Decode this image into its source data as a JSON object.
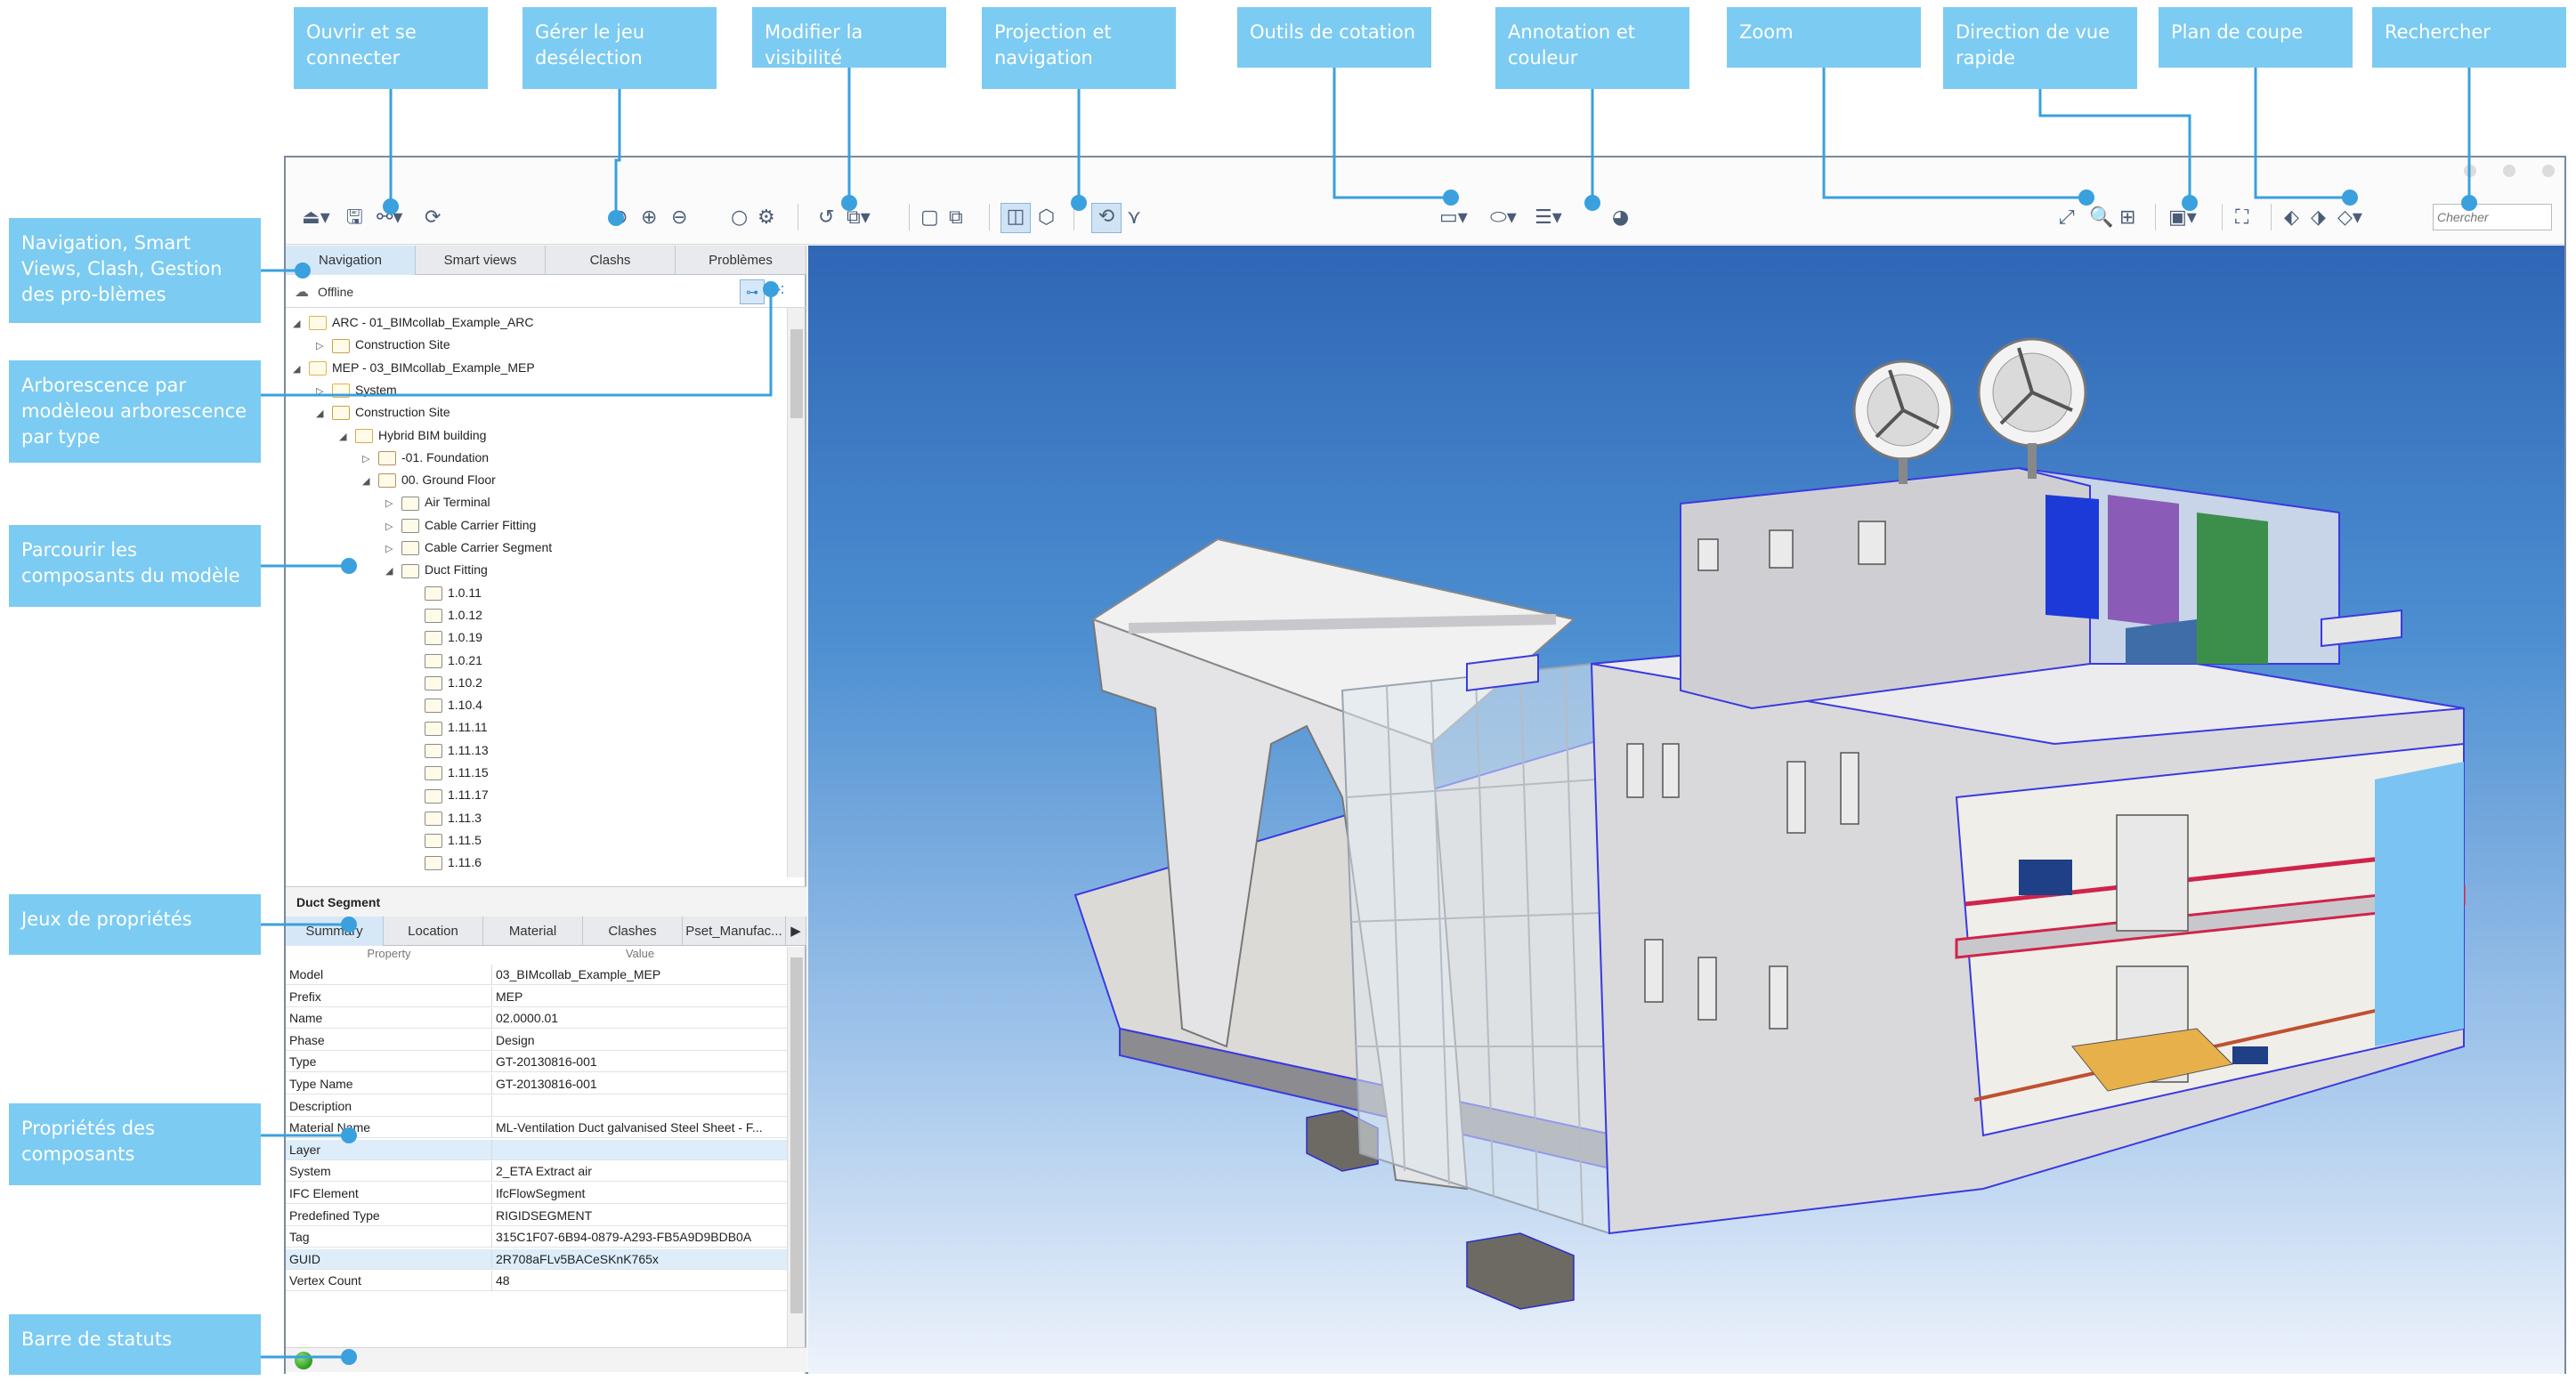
{
  "callouts_top": [
    "Ouvrir et se connecter",
    "Gérer le jeu desélection",
    "Modifier la visibilité",
    "Projection et navigation",
    "Outils de cotation",
    "Annotation et couleur",
    "Zoom",
    "Direction de vue rapide",
    "Plan de coupe",
    "Rechercher"
  ],
  "callouts_left": [
    "Navigation, Smart Views, Clash, Gestion des pro-blèmes",
    "Arborescence par modèleou arborescence par type",
    "Parcourir les composants du modèle",
    "Jeux de propriétés",
    "Propriétés des composants",
    "Barre de statuts"
  ],
  "search": {
    "placeholder": "Chercher"
  },
  "nav_tabs": [
    "Navigation",
    "Smart views",
    "Clashs",
    "Problèmes"
  ],
  "offline_label": "Offline",
  "tree": [
    {
      "label": "ARC - 01_BIMcollab_Example_ARC",
      "arrow": "◢",
      "icon": "folder"
    },
    {
      "label": "Construction Site",
      "arrow": "▷",
      "icon": "site"
    },
    {
      "label": "MEP - 03_BIMcollab_Example_MEP",
      "arrow": "◢",
      "icon": "folder"
    },
    {
      "label": "System",
      "arrow": "▷",
      "icon": "folder"
    },
    {
      "label": "Construction Site",
      "arrow": "◢",
      "icon": "site"
    },
    {
      "label": "Hybrid BIM building",
      "arrow": "◢",
      "icon": "building"
    },
    {
      "label": "-01. Foundation",
      "arrow": "▷",
      "icon": "level"
    },
    {
      "label": "00. Ground Floor",
      "arrow": "◢",
      "icon": "level"
    },
    {
      "label": "Air Terminal",
      "arrow": "▷",
      "icon": "elem"
    },
    {
      "label": "Cable Carrier Fitting",
      "arrow": "▷",
      "icon": "elem"
    },
    {
      "label": "Cable Carrier Segment",
      "arrow": "▷",
      "icon": "elem"
    },
    {
      "label": "Duct Fitting",
      "arrow": "◢",
      "icon": "elem"
    },
    {
      "label": "1.0.11",
      "arrow": "",
      "icon": "elem"
    },
    {
      "label": "1.0.12",
      "arrow": "",
      "icon": "elem"
    },
    {
      "label": "1.0.19",
      "arrow": "",
      "icon": "elem"
    },
    {
      "label": "1.0.21",
      "arrow": "",
      "icon": "elem"
    },
    {
      "label": "1.10.2",
      "arrow": "",
      "icon": "elem"
    },
    {
      "label": "1.10.4",
      "arrow": "",
      "icon": "elem"
    },
    {
      "label": "1.11.11",
      "arrow": "",
      "icon": "elem"
    },
    {
      "label": "1.11.13",
      "arrow": "",
      "icon": "elem"
    },
    {
      "label": "1.11.15",
      "arrow": "",
      "icon": "elem"
    },
    {
      "label": "1.11.17",
      "arrow": "",
      "icon": "elem"
    },
    {
      "label": "1.11.3",
      "arrow": "",
      "icon": "elem"
    },
    {
      "label": "1.11.5",
      "arrow": "",
      "icon": "elem"
    },
    {
      "label": "1.11.6",
      "arrow": "",
      "icon": "elem"
    }
  ],
  "properties": {
    "title": "Duct Segment",
    "tabs": [
      "Summary",
      "Location",
      "Material",
      "Clashes",
      "Pset_Manufac..."
    ],
    "headers": [
      "Property",
      "Value"
    ],
    "rows": [
      [
        "Model",
        "03_BIMcollab_Example_MEP"
      ],
      [
        "Prefix",
        "MEP"
      ],
      [
        "Name",
        "02.0000.01"
      ],
      [
        "Phase",
        "Design"
      ],
      [
        "Type",
        "GT-20130816-001"
      ],
      [
        "Type Name",
        "GT-20130816-001"
      ],
      [
        "Description",
        ""
      ],
      [
        "Material Name",
        "ML-Ventilation Duct galvanised Steel Sheet - F..."
      ],
      [
        "Layer",
        ""
      ],
      [
        "System",
        "2_ETA Extract air"
      ],
      [
        "IFC Element",
        "IfcFlowSegment"
      ],
      [
        "Predefined Type",
        "RIGIDSEGMENT"
      ],
      [
        "Tag",
        "315C1F07-6B94-0879-A293-FB5A9D9BDB0A"
      ],
      [
        "GUID",
        "2R708aFLv5BACeSKnK765x"
      ],
      [
        "Vertex Count",
        "48"
      ]
    ]
  },
  "colors": {
    "callout": "#7ccbf2",
    "accent": "#2f7fd0",
    "status_ok": "#3aa629"
  }
}
